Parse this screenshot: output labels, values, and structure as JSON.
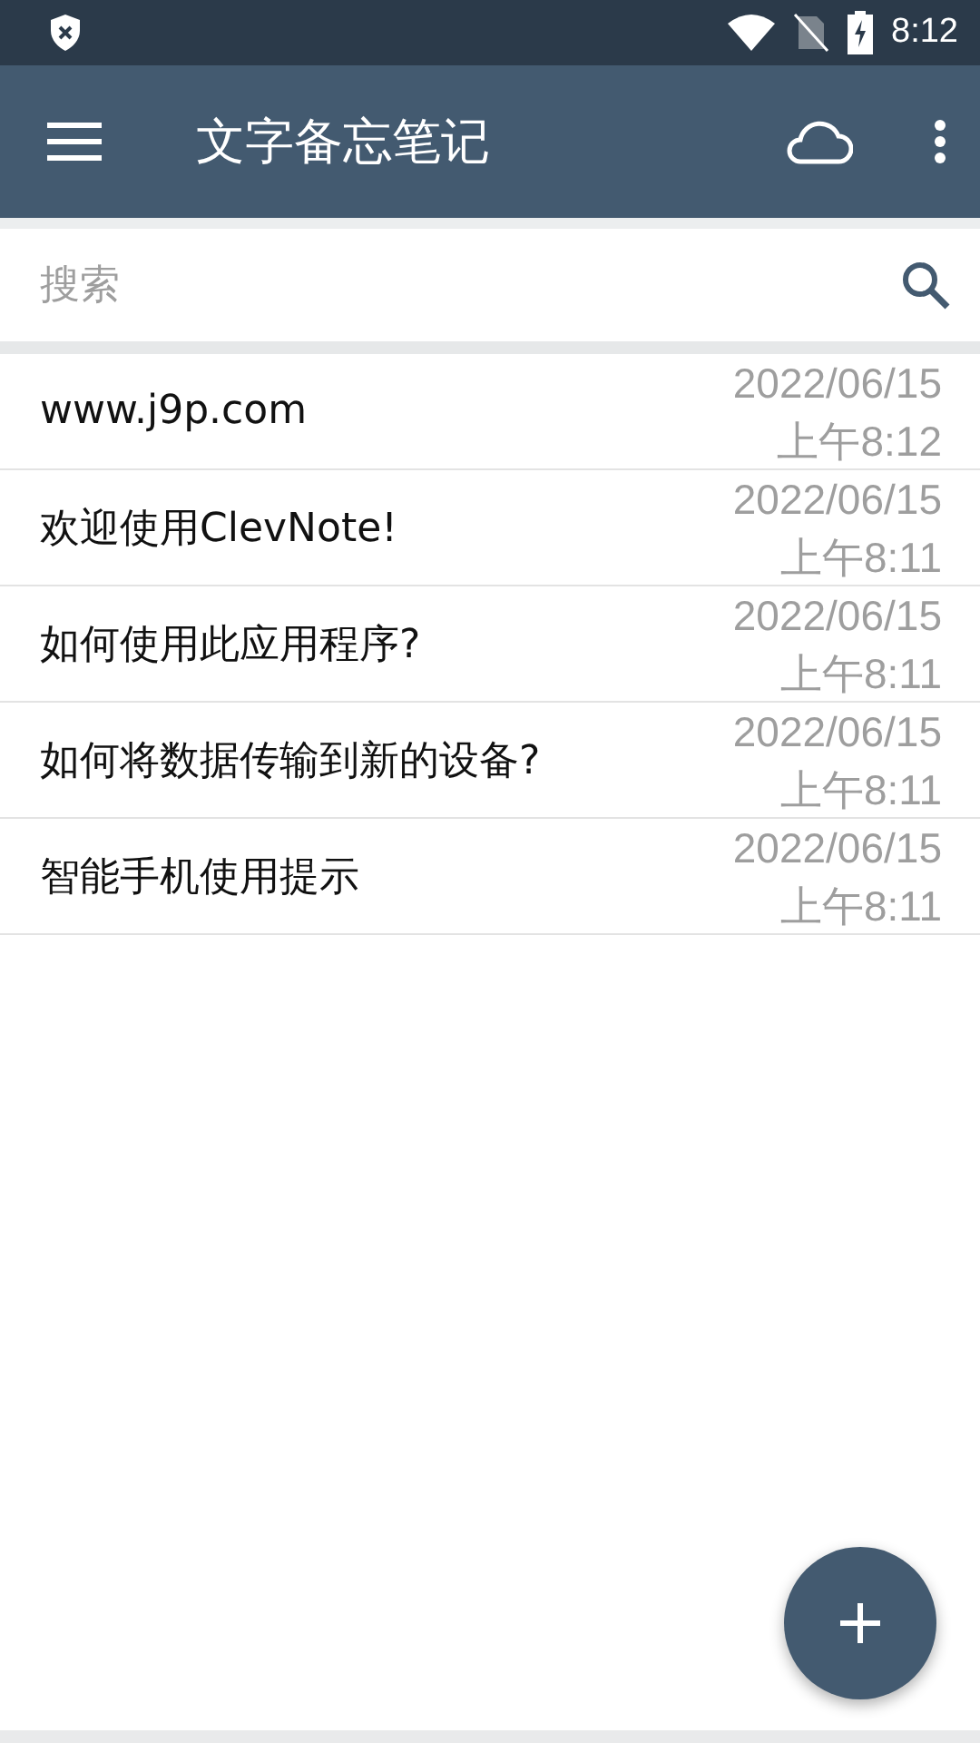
{
  "status_bar": {
    "time": "8:12"
  },
  "app_bar": {
    "title": "文字备忘笔记"
  },
  "search": {
    "placeholder": "搜索"
  },
  "notes": [
    {
      "title": "www.j9p.com",
      "date": "2022/06/15",
      "time": "上午8:12"
    },
    {
      "title": "欢迎使用ClevNote!",
      "date": "2022/06/15",
      "time": "上午8:11"
    },
    {
      "title": "如何使用此应用程序?",
      "date": "2022/06/15",
      "time": "上午8:11"
    },
    {
      "title": "如何将数据传输到新的设备?",
      "date": "2022/06/15",
      "time": "上午8:11"
    },
    {
      "title": "智能手机使用提示",
      "date": "2022/06/15",
      "time": "上午8:11"
    }
  ]
}
